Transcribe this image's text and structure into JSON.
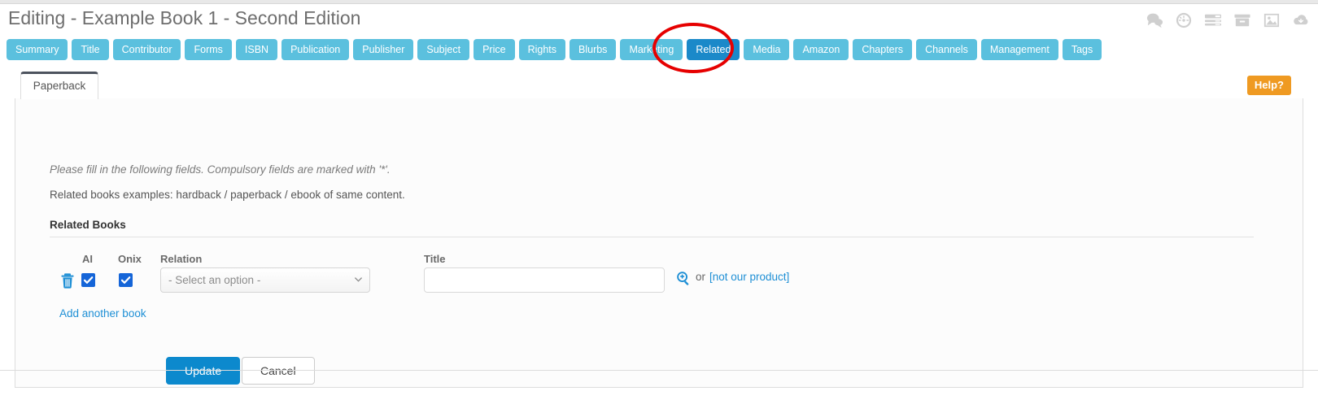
{
  "header": {
    "title": "Editing - Example Book 1 - Second Edition",
    "icons": [
      {
        "name": "comments-icon"
      },
      {
        "name": "dashboard-gauge-icon"
      },
      {
        "name": "list-view-icon"
      },
      {
        "name": "archive-box-icon"
      },
      {
        "name": "image-icon"
      },
      {
        "name": "cloud-download-icon"
      }
    ]
  },
  "tabs": {
    "items": [
      {
        "label": "Summary",
        "active": false
      },
      {
        "label": "Title",
        "active": false
      },
      {
        "label": "Contributor",
        "active": false
      },
      {
        "label": "Forms",
        "active": false
      },
      {
        "label": "ISBN",
        "active": false
      },
      {
        "label": "Publication",
        "active": false
      },
      {
        "label": "Publisher",
        "active": false
      },
      {
        "label": "Subject",
        "active": false
      },
      {
        "label": "Price",
        "active": false
      },
      {
        "label": "Rights",
        "active": false
      },
      {
        "label": "Blurbs",
        "active": false
      },
      {
        "label": "Marketing",
        "active": false
      },
      {
        "label": "Related",
        "active": true
      },
      {
        "label": "Media",
        "active": false
      },
      {
        "label": "Amazon",
        "active": false
      },
      {
        "label": "Chapters",
        "active": false
      },
      {
        "label": "Channels",
        "active": false
      },
      {
        "label": "Management",
        "active": false
      },
      {
        "label": "Tags",
        "active": false
      }
    ],
    "active_color": "#1b89c9",
    "inactive_color": "#5bc0de",
    "annotation_color": "#e60000"
  },
  "panel": {
    "subtab_label": "Paperback",
    "help_label": "Help?",
    "help_color": "#ef9a22",
    "instruction_italic": "Please fill in the following fields. Compulsory fields are marked with '*'.",
    "instruction_plain": "Related books examples: hardback / paperback / ebook of same content.",
    "section_title": "Related Books"
  },
  "table": {
    "columns": {
      "ai": "AI",
      "onix": "Onix",
      "relation": "Relation",
      "title": "Title"
    },
    "row": {
      "delete_icon": "trash-icon",
      "ai_checked": true,
      "onix_checked": true,
      "relation_value": "- Select an option -",
      "title_value": "",
      "title_placeholder": "",
      "search_icon": "search-plus-icon",
      "or_text": "or",
      "not_our_product_label": "[not our product]"
    }
  },
  "actions": {
    "add_another": "Add another book",
    "update_label": "Update",
    "cancel_label": "Cancel",
    "update_color": "#0c89cd",
    "link_color": "#1e8fd5"
  }
}
